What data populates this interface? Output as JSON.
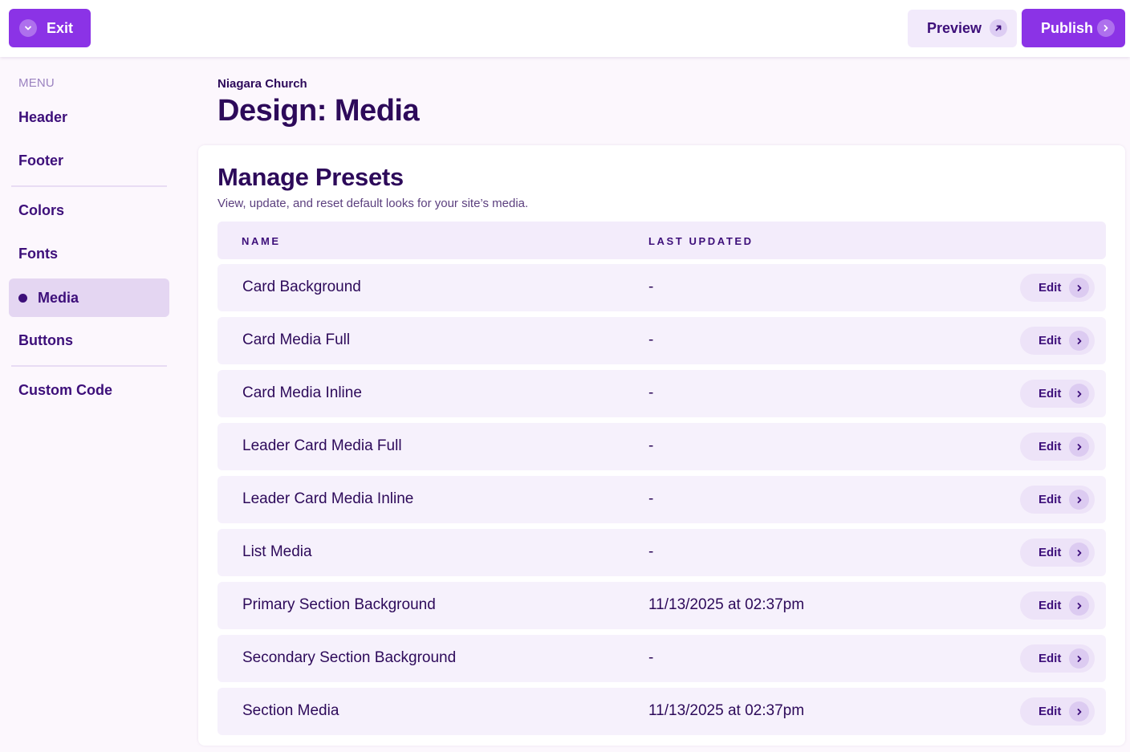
{
  "topbar": {
    "exit_label": "Exit",
    "preview_label": "Preview",
    "publish_label": "Publish"
  },
  "sidebar": {
    "heading": "MENU",
    "items": [
      {
        "label": "Header"
      },
      {
        "label": "Footer"
      },
      {
        "label": "Colors"
      },
      {
        "label": "Fonts"
      },
      {
        "label": "Media",
        "active": true
      },
      {
        "label": "Buttons"
      },
      {
        "label": "Custom Code"
      }
    ]
  },
  "page": {
    "org_name": "Niagara Church",
    "title": "Design: Media"
  },
  "presets": {
    "title": "Manage Presets",
    "subtitle": "View, update, and reset default looks for your site’s media.",
    "columns": {
      "name": "NAME",
      "last_updated": "LAST UPDATED"
    },
    "edit_label": "Edit",
    "rows": [
      {
        "name": "Card Background",
        "last_updated": "-"
      },
      {
        "name": "Card Media Full",
        "last_updated": "-"
      },
      {
        "name": "Card Media Inline",
        "last_updated": "-"
      },
      {
        "name": "Leader Card Media Full",
        "last_updated": "-"
      },
      {
        "name": "Leader Card Media Inline",
        "last_updated": "-"
      },
      {
        "name": "List Media",
        "last_updated": "-"
      },
      {
        "name": "Primary Section Background",
        "last_updated": "11/13/2025 at 02:37pm"
      },
      {
        "name": "Secondary Section Background",
        "last_updated": "-"
      },
      {
        "name": "Section Media",
        "last_updated": "11/13/2025 at 02:37pm"
      }
    ]
  },
  "colors": {
    "accent": "#8b33e6",
    "text": "#2d0a5a",
    "row_bg": "#f6f1fc",
    "page_bg": "#fcf7fd"
  },
  "icons": {
    "exit": "chevron-down-icon",
    "preview": "arrow-up-right-icon",
    "publish": "chevron-right-icon",
    "edit": "chevron-right-icon",
    "active_marker": "dot-icon"
  }
}
